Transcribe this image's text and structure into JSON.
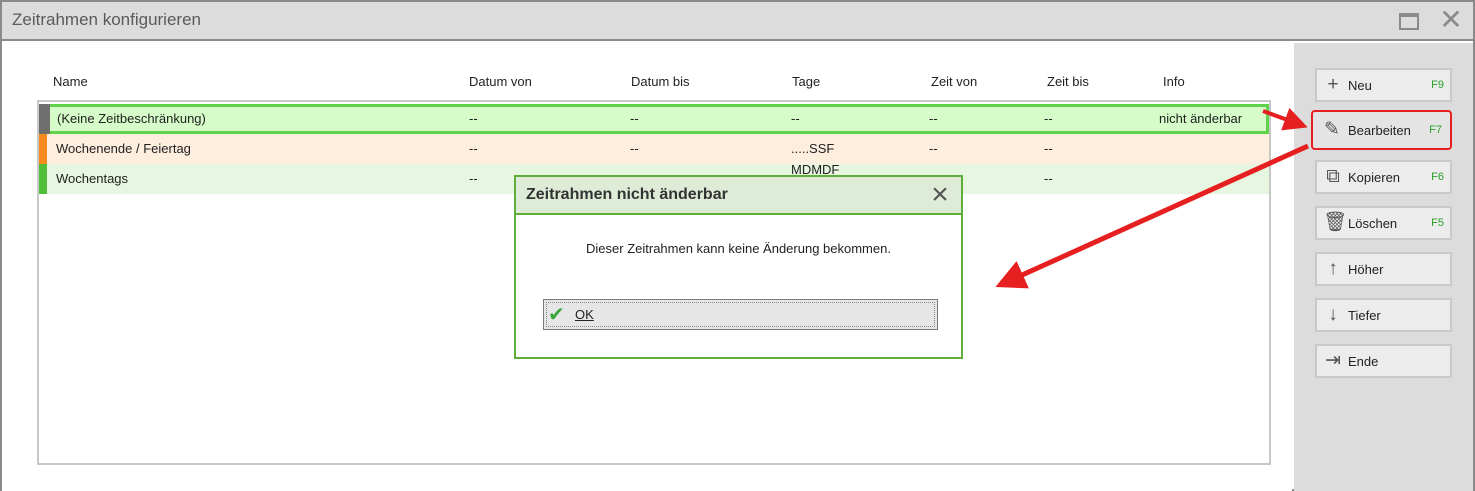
{
  "window": {
    "title": "Zeitrahmen konfigurieren"
  },
  "table": {
    "columns": [
      "Name",
      "Datum von",
      "Datum bis",
      "Tage",
      "Zeit von",
      "Zeit bis",
      "Info"
    ],
    "rows": [
      {
        "name": "(Keine Zeitbeschränkung)",
        "datum_von": "--",
        "datum_bis": "--",
        "tage": "--",
        "zeit_von": "--",
        "zeit_bis": "--",
        "info": "nicht änderbar",
        "bar_color": "#6f6f6f",
        "bg": "#d6fcc9"
      },
      {
        "name": "Wochenende / Feiertag",
        "datum_von": "--",
        "datum_bis": "--",
        "tage": ".....SSF",
        "zeit_von": "--",
        "zeit_bis": "--",
        "info": "",
        "bar_color": "#f58a1e",
        "bg": "#fdeedd"
      },
      {
        "name": "Wochentags",
        "datum_von": "--",
        "datum_bis": "",
        "tage": "MDMDF",
        "zeit_von": "",
        "zeit_bis": "--",
        "info": "",
        "bar_color": "#4fbf3a",
        "bg": "#e6f6e0"
      }
    ]
  },
  "sidebar": {
    "buttons": [
      {
        "icon": "plus-icon",
        "glyph": "+",
        "label": "Neu",
        "key": "F9"
      },
      {
        "icon": "pencil-icon",
        "glyph": "✎",
        "label": "Bearbeiten",
        "key": "F7"
      },
      {
        "icon": "copy-icon",
        "glyph": "⧉",
        "label": "Kopieren",
        "key": "F6"
      },
      {
        "icon": "trash-icon",
        "glyph": "🗑",
        "label": "Löschen",
        "key": "F5"
      },
      {
        "icon": "arrow-up-icon",
        "glyph": "↑",
        "label": "Höher",
        "key": ""
      },
      {
        "icon": "arrow-down-icon",
        "glyph": "↓",
        "label": "Tiefer",
        "key": ""
      },
      {
        "icon": "exit-icon",
        "glyph": "⇥",
        "label": "Ende",
        "key": ""
      }
    ]
  },
  "dialog": {
    "title": "Zeitrahmen nicht änderbar",
    "message": "Dieser Zeitrahmen kann keine Änderung bekommen.",
    "ok_label": "OK"
  },
  "colors": {
    "accent_green": "#5fae3a",
    "annotation_red": "#e62020"
  }
}
